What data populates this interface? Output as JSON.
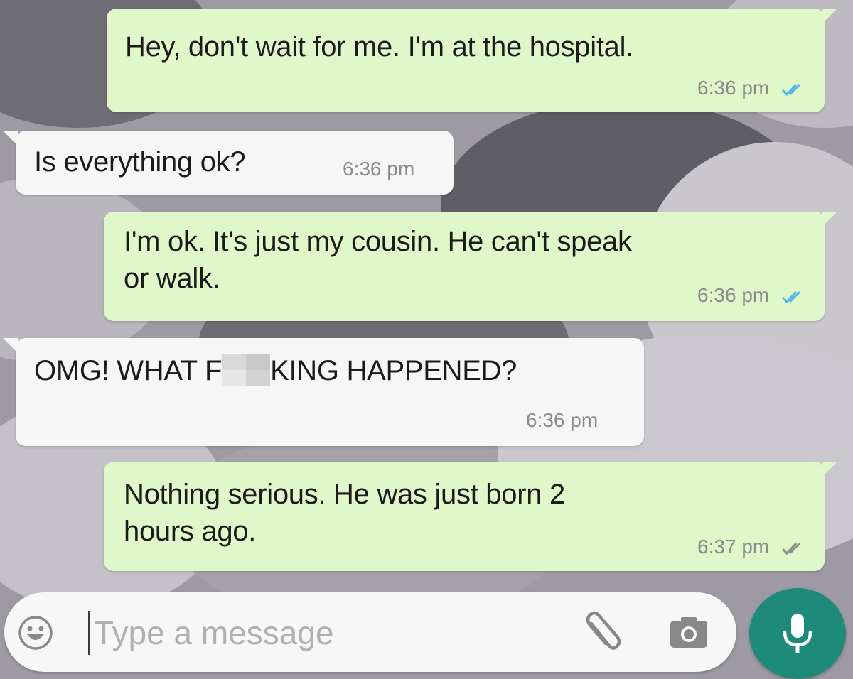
{
  "chat": {
    "messages": [
      {
        "direction": "outgoing",
        "text": "Hey, don't wait for me. I'm at the hospital.",
        "time": "6:36 pm",
        "status": "read"
      },
      {
        "direction": "incoming",
        "text": "Is everything ok?",
        "time": "6:36 pm"
      },
      {
        "direction": "outgoing",
        "text_line1": "I'm ok. It's just my cousin. He can't speak",
        "text_line2": "or walk.",
        "time": "6:36 pm",
        "status": "read"
      },
      {
        "direction": "incoming",
        "text_before": "OMG! WHAT F",
        "text_after": "KING HAPPENED?",
        "time": "6:36 pm"
      },
      {
        "direction": "outgoing",
        "text_line1": "Nothing serious. He was just born 2",
        "text_line2": "hours ago.",
        "time": "6:37 pm",
        "status": "read"
      }
    ]
  },
  "composer": {
    "placeholder": "Type a message",
    "icons": {
      "emoji": "emoji-smiley-icon",
      "attach": "paperclip-icon",
      "camera": "camera-icon",
      "mic": "microphone-icon"
    }
  },
  "colors": {
    "outgoing_bubble": "#dff7c9",
    "incoming_bubble": "#f6f6f6",
    "mic_button": "#1e8a79",
    "read_ticks": "#4fb6ec",
    "timestamp": "#8a8a8a"
  }
}
